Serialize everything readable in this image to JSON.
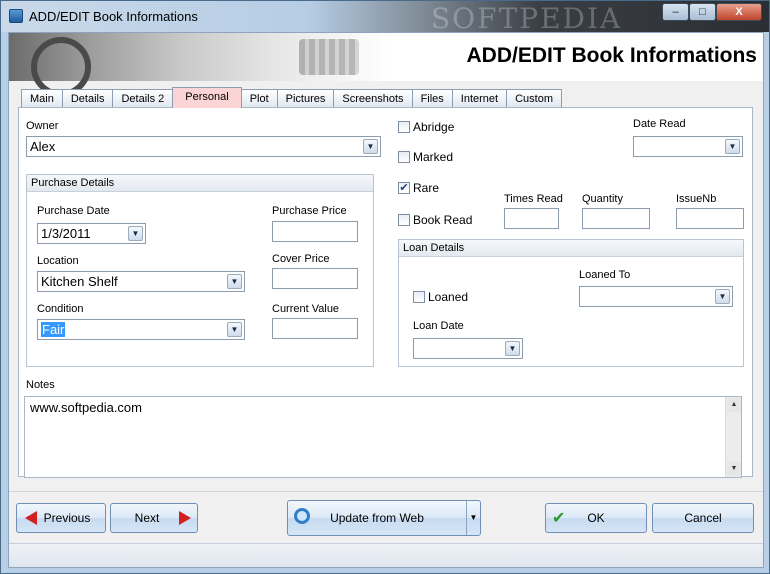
{
  "window": {
    "title": "ADD/EDIT Book Informations",
    "watermark": "SOFTPEDIA",
    "min_label": "–",
    "max_label": "□",
    "close_label": "X"
  },
  "header": {
    "title": "ADD/EDIT Book Informations"
  },
  "tabs": [
    {
      "label": "Main"
    },
    {
      "label": "Details"
    },
    {
      "label": "Details 2"
    },
    {
      "label": "Personal",
      "active": true
    },
    {
      "label": "Plot"
    },
    {
      "label": "Pictures"
    },
    {
      "label": "Screenshots"
    },
    {
      "label": "Files"
    },
    {
      "label": "Internet"
    },
    {
      "label": "Custom"
    }
  ],
  "owner": {
    "label": "Owner",
    "value": "Alex"
  },
  "purchase": {
    "group_label": "Purchase Details",
    "date_label": "Purchase Date",
    "date_value": "1/3/2011",
    "price_label": "Purchase Price",
    "price_value": "",
    "location_label": "Location",
    "location_value": "Kitchen Shelf",
    "cover_label": "Cover Price",
    "cover_value": "",
    "condition_label": "Condition",
    "condition_value": "Fair",
    "current_label": "Current Value",
    "current_value": ""
  },
  "flags": {
    "abridge": {
      "label": "Abridge",
      "checked": false
    },
    "marked": {
      "label": "Marked",
      "checked": false
    },
    "rare": {
      "label": "Rare",
      "checked": true
    },
    "book_read": {
      "label": "Book Read",
      "checked": false
    }
  },
  "date_read": {
    "label": "Date Read",
    "value": ""
  },
  "counts": {
    "times_read_label": "Times Read",
    "times_read_value": "",
    "quantity_label": "Quantity",
    "quantity_value": "",
    "issue_label": "IssueNb",
    "issue_value": ""
  },
  "loan": {
    "group_label": "Loan Details",
    "loaned_label": "Loaned",
    "loaned_checked": false,
    "loaned_to_label": "Loaned To",
    "loaned_to_value": "",
    "loan_date_label": "Loan Date",
    "loan_date_value": ""
  },
  "notes": {
    "label": "Notes",
    "value": "www.softpedia.com"
  },
  "buttons": {
    "previous": "Previous",
    "next": "Next",
    "update": "Update from Web",
    "ok": "OK",
    "cancel": "Cancel"
  },
  "glyphs": {
    "dropdown": "▼",
    "check": "✔",
    "up": "▲",
    "down": "▼",
    "checkmark_big": "✔"
  }
}
